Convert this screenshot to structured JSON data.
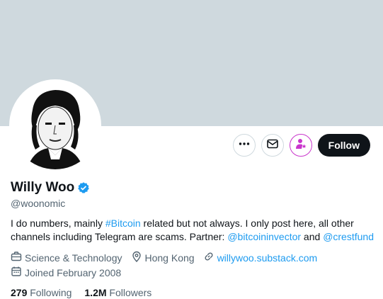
{
  "profile": {
    "name": "Willy Woo",
    "handle": "@woonomic",
    "verified_color": "#1d9bf0",
    "bio_text_1": "I do numbers, mainly ",
    "bio_hashtag": "#Bitcoin",
    "bio_text_2": " related but not always. I only post here, all other channels including Telegram are scams. Partner: ",
    "bio_mention_1": "@bitcoininvector",
    "bio_text_3": " and ",
    "bio_mention_2": "@crestfund",
    "category": "Science & Technology",
    "location": "Hong Kong",
    "website": "willywoo.substack.com",
    "joined": "Joined February 2008",
    "following_count": "279",
    "following_label": "Following",
    "followers_count": "1.2M",
    "followers_label": "Followers"
  },
  "actions": {
    "more_icon": "more-dots-icon",
    "message_icon": "envelope-icon",
    "subscribe_icon": "subscribe-person-star-icon",
    "follow_label": "Follow"
  },
  "colors": {
    "banner": "#cfd9de",
    "link": "#1d9bf0",
    "subscribe": "#c936cc",
    "follow_bg": "#0f1419"
  }
}
